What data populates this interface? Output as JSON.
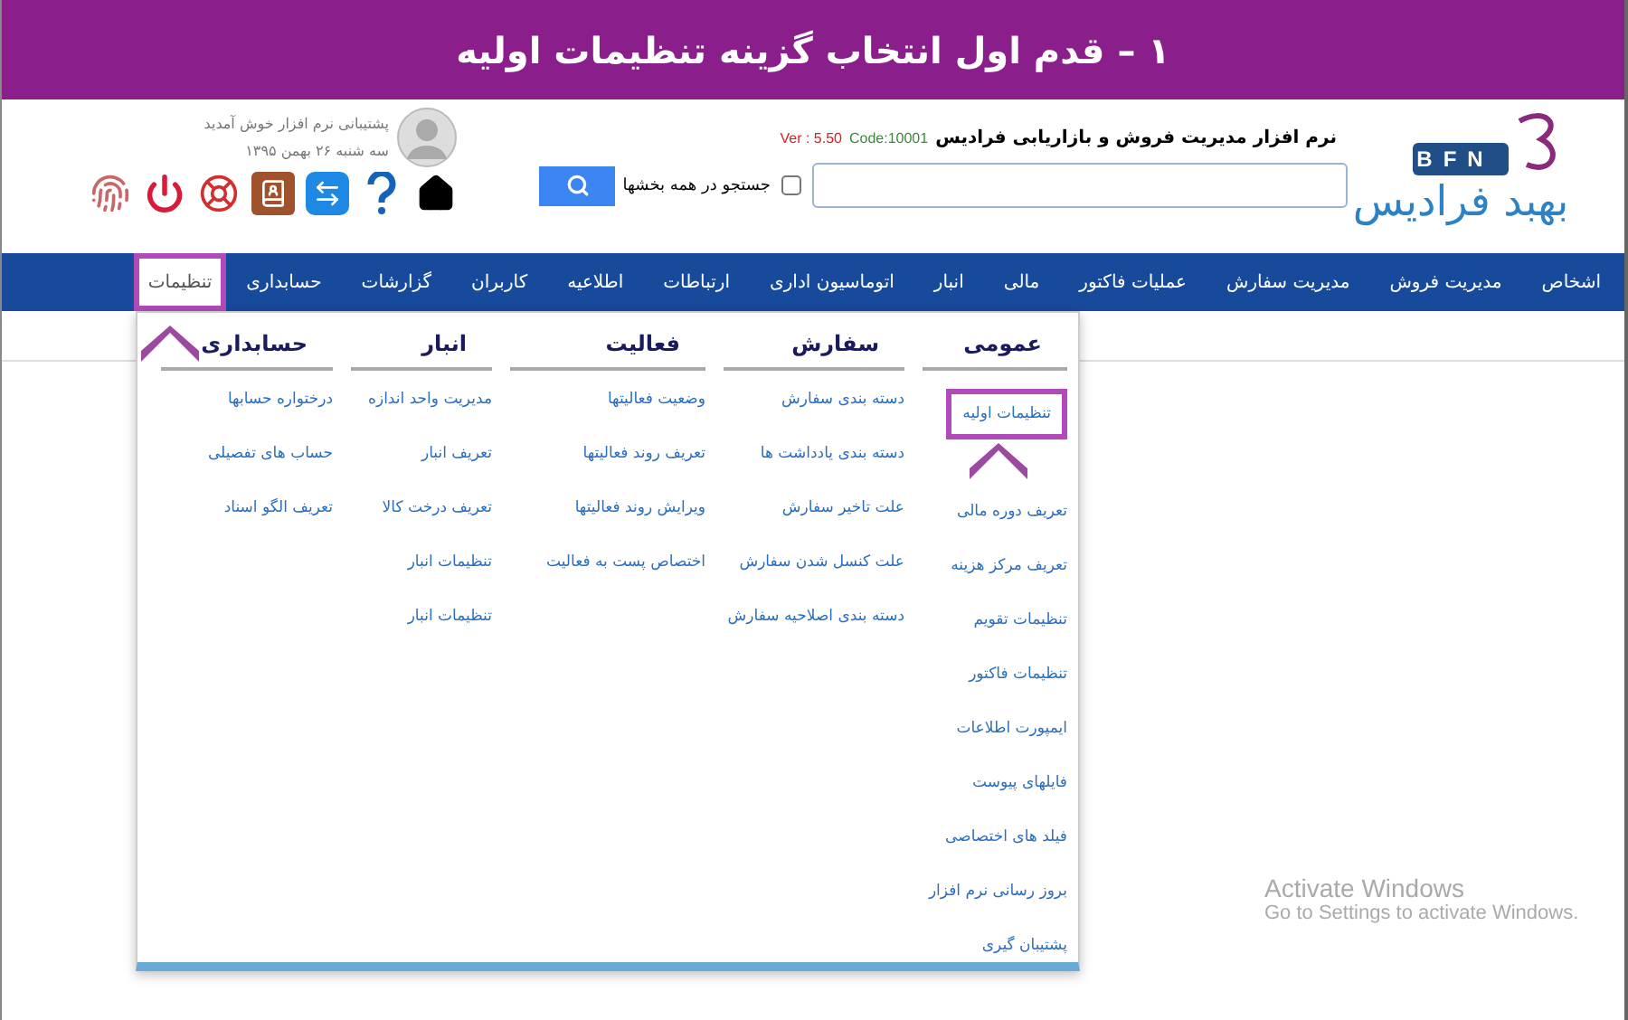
{
  "banner": {
    "title": "۱ – قدم اول انتخاب گزینه تنظیمات اولیه"
  },
  "header": {
    "logo": {
      "badge": "BFN",
      "name": "بهبد فرادیس"
    },
    "app_title": "نرم افزار مدیریت فروش و بازاریابی فرادیس",
    "code": "Code:10001",
    "version": "Ver : 5.50",
    "search": {
      "all_sections": {
        "label": "جستجو در همه بخشها",
        "checked": false
      }
    },
    "user": {
      "greeting": "پشتیبانی نرم افزار خوش آمدید",
      "date": "سه شنبه ۲۶ بهمن ۱۳۹۵"
    },
    "toolbar": [
      {
        "kind": "home"
      },
      {
        "kind": "help"
      },
      {
        "kind": "remote"
      },
      {
        "kind": "contacts"
      },
      {
        "kind": "support"
      },
      {
        "kind": "logout"
      },
      {
        "kind": "fingerprint"
      }
    ]
  },
  "nav": [
    {
      "label": "اشخاص",
      "selected": false
    },
    {
      "label": "مدیریت فروش",
      "selected": false
    },
    {
      "label": "مدیریت سفارش",
      "selected": false
    },
    {
      "label": "عملیات فاکتور",
      "selected": false
    },
    {
      "label": "مالی",
      "selected": false
    },
    {
      "label": "انبار",
      "selected": false
    },
    {
      "label": "اتوماسیون اداری",
      "selected": false
    },
    {
      "label": "ارتباطات",
      "selected": false
    },
    {
      "label": "اطلاعیه",
      "selected": false
    },
    {
      "label": "کاربران",
      "selected": false
    },
    {
      "label": "گزارشات",
      "selected": false
    },
    {
      "label": "حسابداری",
      "selected": false
    },
    {
      "label": "تنظیمات",
      "selected": true
    }
  ],
  "menu": [
    {
      "heading": "عمومی",
      "items": [
        {
          "label": "تنظیمات اولیه",
          "highlighted": true
        },
        {
          "label": "تعریف دوره مالی",
          "highlighted": false
        },
        {
          "label": "تعریف مرکز هزینه",
          "highlighted": false
        },
        {
          "label": "تنظیمات تقویم",
          "highlighted": false
        },
        {
          "label": "تنظیمات فاکتور",
          "highlighted": false
        },
        {
          "label": "ایمپورت اطلاعات",
          "highlighted": false
        },
        {
          "label": "فایلهای پیوست",
          "highlighted": false
        },
        {
          "label": "فیلد های اختصاصی",
          "highlighted": false
        },
        {
          "label": "بروز رسانی نرم افزار",
          "highlighted": false
        },
        {
          "label": "پشتیبان گیری",
          "highlighted": false
        }
      ]
    },
    {
      "heading": "سفارش",
      "items": [
        {
          "label": "دسته بندی سفارش",
          "highlighted": false
        },
        {
          "label": "دسته بندی یادداشت ها",
          "highlighted": false
        },
        {
          "label": "علت تاخیر سفارش",
          "highlighted": false
        },
        {
          "label": "علت کنسل شدن سفارش",
          "highlighted": false
        },
        {
          "label": "دسته بندی اصلاحیه سفارش",
          "highlighted": false
        }
      ]
    },
    {
      "heading": "فعالیت",
      "items": [
        {
          "label": "وضعیت فعالیتها",
          "highlighted": false
        },
        {
          "label": "تعریف روند فعالیتها",
          "highlighted": false
        },
        {
          "label": "ویرایش روند فعالیتها",
          "highlighted": false
        },
        {
          "label": "اختصاص پست به فعالیت",
          "highlighted": false
        }
      ]
    },
    {
      "heading": "انبار",
      "items": [
        {
          "label": "مدیریت واحد اندازه",
          "highlighted": false
        },
        {
          "label": "تعریف انبار",
          "highlighted": false
        },
        {
          "label": "تعریف درخت کالا",
          "highlighted": false
        },
        {
          "label": "تنظیمات انبار",
          "highlighted": false
        },
        {
          "label": "تنظیمات انبار",
          "highlighted": false
        }
      ]
    },
    {
      "heading": "حسابداری",
      "items": [
        {
          "label": "درختواره حسابها",
          "highlighted": false
        },
        {
          "label": "حساب های تفصیلی",
          "highlighted": false
        },
        {
          "label": "تعریف الگو اسناد",
          "highlighted": false
        }
      ]
    }
  ],
  "os_notice": {
    "title": "Activate Windows",
    "text": "Go to Settings to activate Windows."
  }
}
